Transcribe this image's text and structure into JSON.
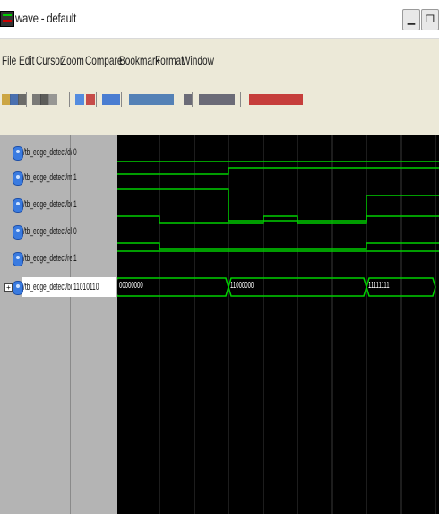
{
  "window": {
    "title": "wave - default",
    "minimize_glyph": "▁",
    "restore_glyph": "❐"
  },
  "menu": [
    "File",
    "Edit",
    "Cursor",
    "Zoom",
    "Compare",
    "Bookmark",
    "Format",
    "Window"
  ],
  "toolbar_icons": [
    "open-icon",
    "save-icon",
    "print-icon",
    "cut-icon",
    "copy-icon",
    "paste-icon",
    "find-icon",
    "delete-icon",
    "wave-cursor-icon",
    "zoom-in-icon",
    "zoom-out-icon",
    "zoom-full-icon",
    "zoom-area-icon",
    "bookmark-icon",
    "compare-icon",
    "list-icon",
    "format-icon",
    "edge-prev-icon",
    "edge-next-icon",
    "edge-falling-icon",
    "edge-rising-icon",
    "step-icon"
  ],
  "signals": [
    {
      "name": "/tb_edge_detect/data",
      "value": "0",
      "type": "bit"
    },
    {
      "name": "/tb_edge_detect/mode",
      "value": "1",
      "type": "bit"
    },
    {
      "name": "/tb_edge_detect/bus_",
      "value": "1",
      "type": "bit"
    },
    {
      "name": "/tb_edge_detect/clk",
      "value": "0",
      "type": "bit"
    },
    {
      "name": "/tb_edge_detect/reset",
      "value": "1",
      "type": "bit"
    },
    {
      "name": "/tb_edge_detect/bus",
      "value": "11010110",
      "type": "bus",
      "expand": "+"
    }
  ],
  "bus_values": [
    "00000000",
    "11000000",
    "11111111"
  ],
  "colors": {
    "wave": "#00d000",
    "grid": "#3a3a3a",
    "background": "#000000"
  }
}
